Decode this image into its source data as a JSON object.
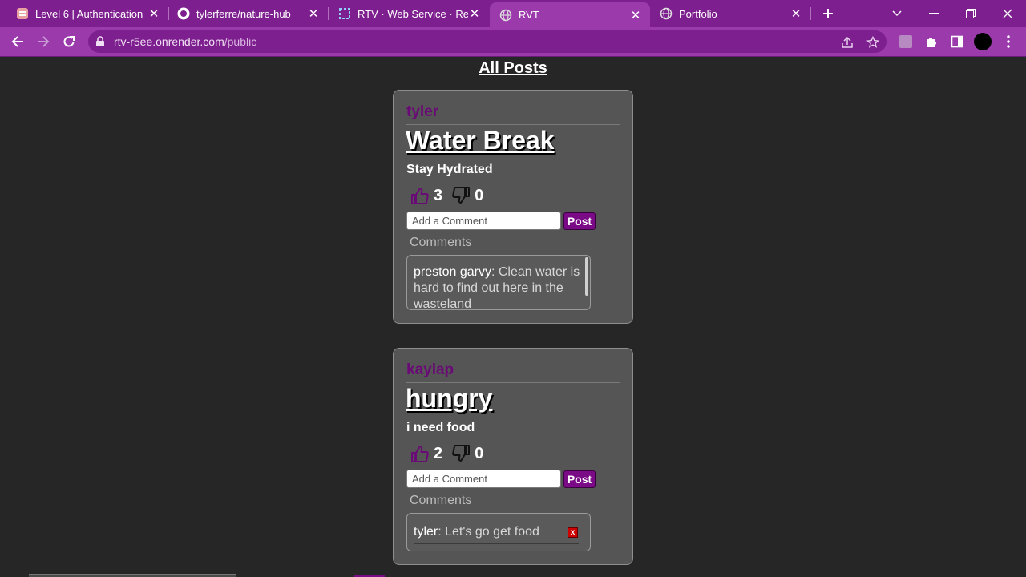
{
  "browser": {
    "tabs": [
      {
        "title": "Level 6 | Authentication",
        "icon": "document-icon"
      },
      {
        "title": "tylerferre/nature-hub",
        "icon": "github-icon"
      },
      {
        "title": "RTV · Web Service · Render",
        "icon": "render-icon"
      },
      {
        "title": "RVT",
        "icon": "globe-icon",
        "active": true
      },
      {
        "title": "Portfolio",
        "icon": "globe-icon"
      }
    ],
    "url_host": "rtv-r5ee.onrender.com",
    "url_path": "/public",
    "accent_color": "#9a3aab",
    "tabbar_color": "#7e1f8f"
  },
  "page": {
    "heading": "All Posts",
    "background": "#262626"
  },
  "posts": [
    {
      "author": "tyler",
      "title": "Water Break",
      "description": "Stay Hydrated",
      "likes": "3",
      "dislikes": "0",
      "comment_placeholder": "Add a Comment",
      "post_label": "Post",
      "comments_label": "Comments",
      "comments": [
        {
          "author": "preston garvy",
          "text": "Clean water is hard to find out here in the wasteland"
        }
      ]
    },
    {
      "author": "kaylap",
      "title": "hungry",
      "description": "i need food",
      "likes": "2",
      "dislikes": "0",
      "comment_placeholder": "Add a Comment",
      "post_label": "Post",
      "comments_label": "Comments",
      "comments": [
        {
          "author": "tyler",
          "text": "Let's go get food",
          "delete_label": "x"
        }
      ]
    }
  ],
  "colors": {
    "author": "#6a0a76",
    "post_button": "#7a0a86",
    "card": "#555555"
  }
}
